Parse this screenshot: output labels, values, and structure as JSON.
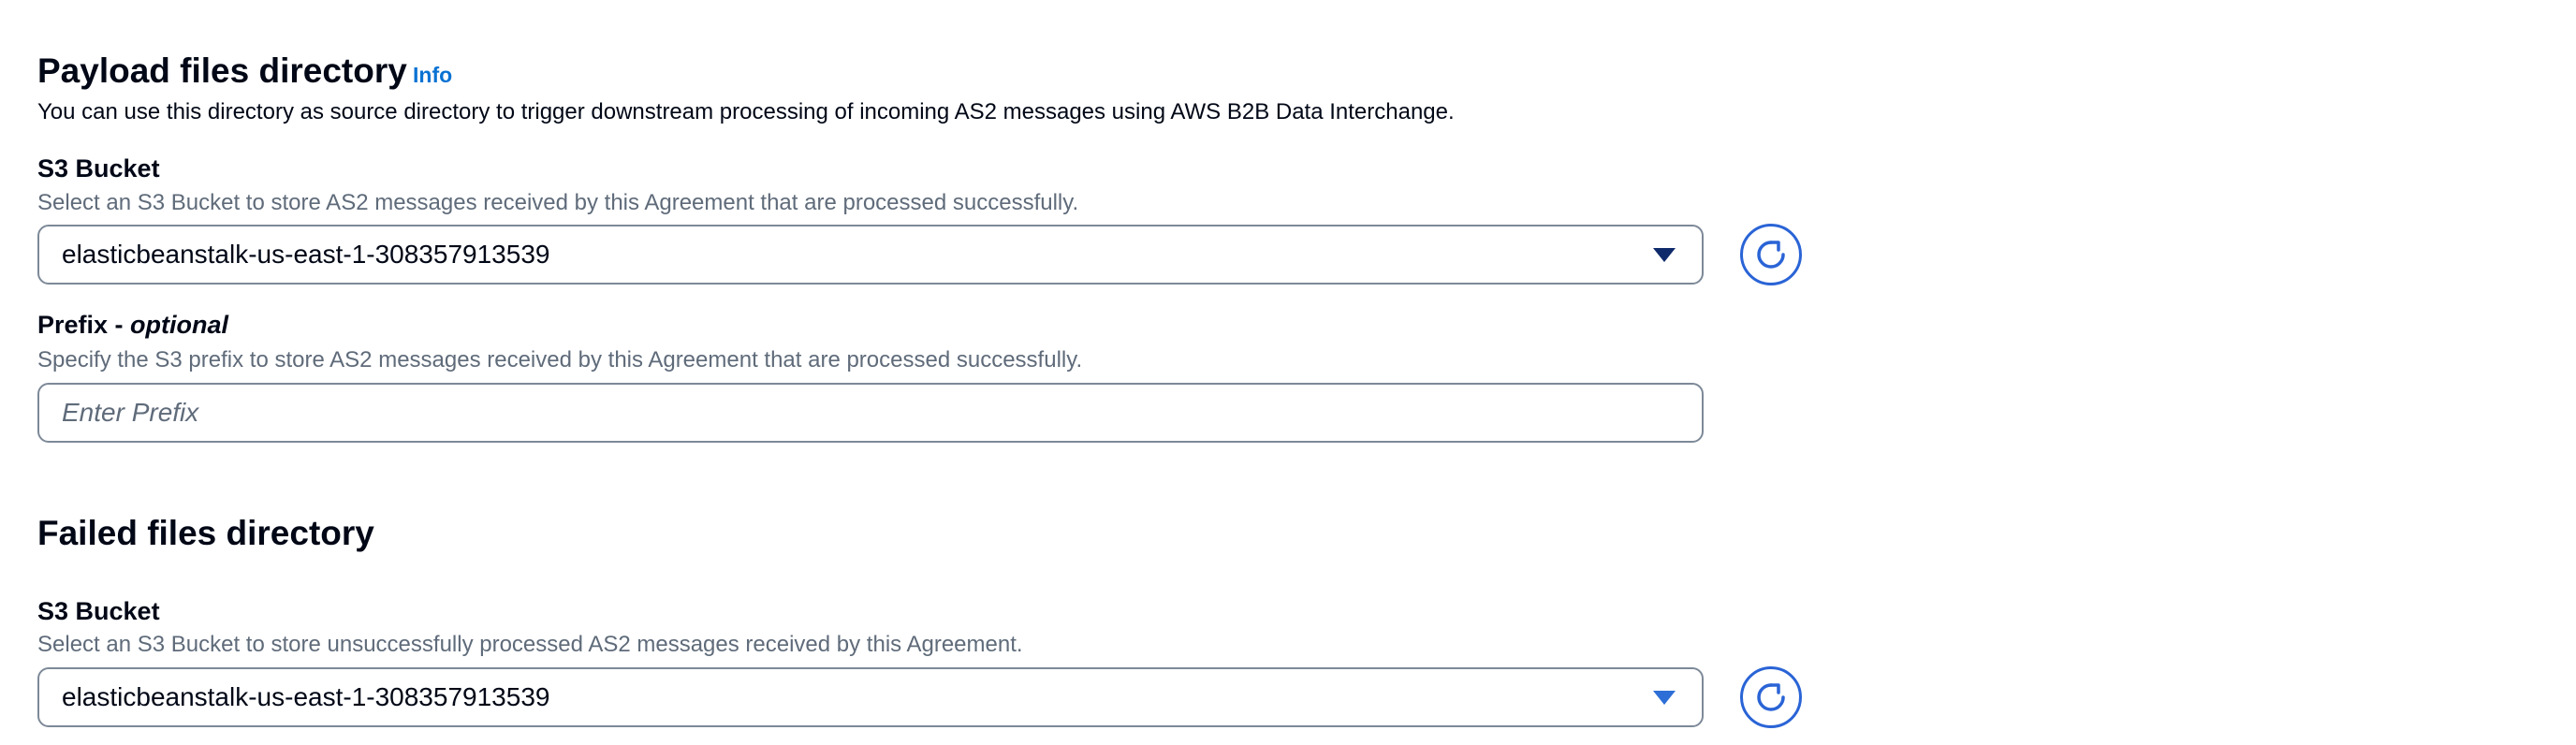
{
  "payload_section": {
    "title": "Payload files directory",
    "info_link": "Info",
    "description": "You can use this directory as source directory to trigger downstream processing of incoming AS2 messages using AWS B2B Data Interchange.",
    "s3_bucket": {
      "label": "S3 Bucket",
      "hint": "Select an S3 Bucket to store AS2 messages received by this Agreement that are processed successfully.",
      "selected_value": "elasticbeanstalk-us-east-1-308357913539"
    },
    "prefix": {
      "label": "Prefix - ",
      "label_optional": "optional",
      "hint": "Specify the S3 prefix to store AS2 messages received by this Agreement that are processed successfully.",
      "placeholder": "Enter Prefix",
      "value": ""
    }
  },
  "failed_section": {
    "title": "Failed files directory",
    "s3_bucket": {
      "label": "S3 Bucket",
      "hint": "Select an S3 Bucket to store unsuccessfully processed AS2 messages received by this Agreement.",
      "selected_value": "elasticbeanstalk-us-east-1-308357913539"
    }
  },
  "icons": {
    "dropdown": "caret-down-icon",
    "refresh": "refresh-icon"
  },
  "colors": {
    "link": "#0972d3",
    "refresh_icon": "#2a64d6",
    "border": "#7d8998",
    "hint_text": "#5f6b7a"
  }
}
